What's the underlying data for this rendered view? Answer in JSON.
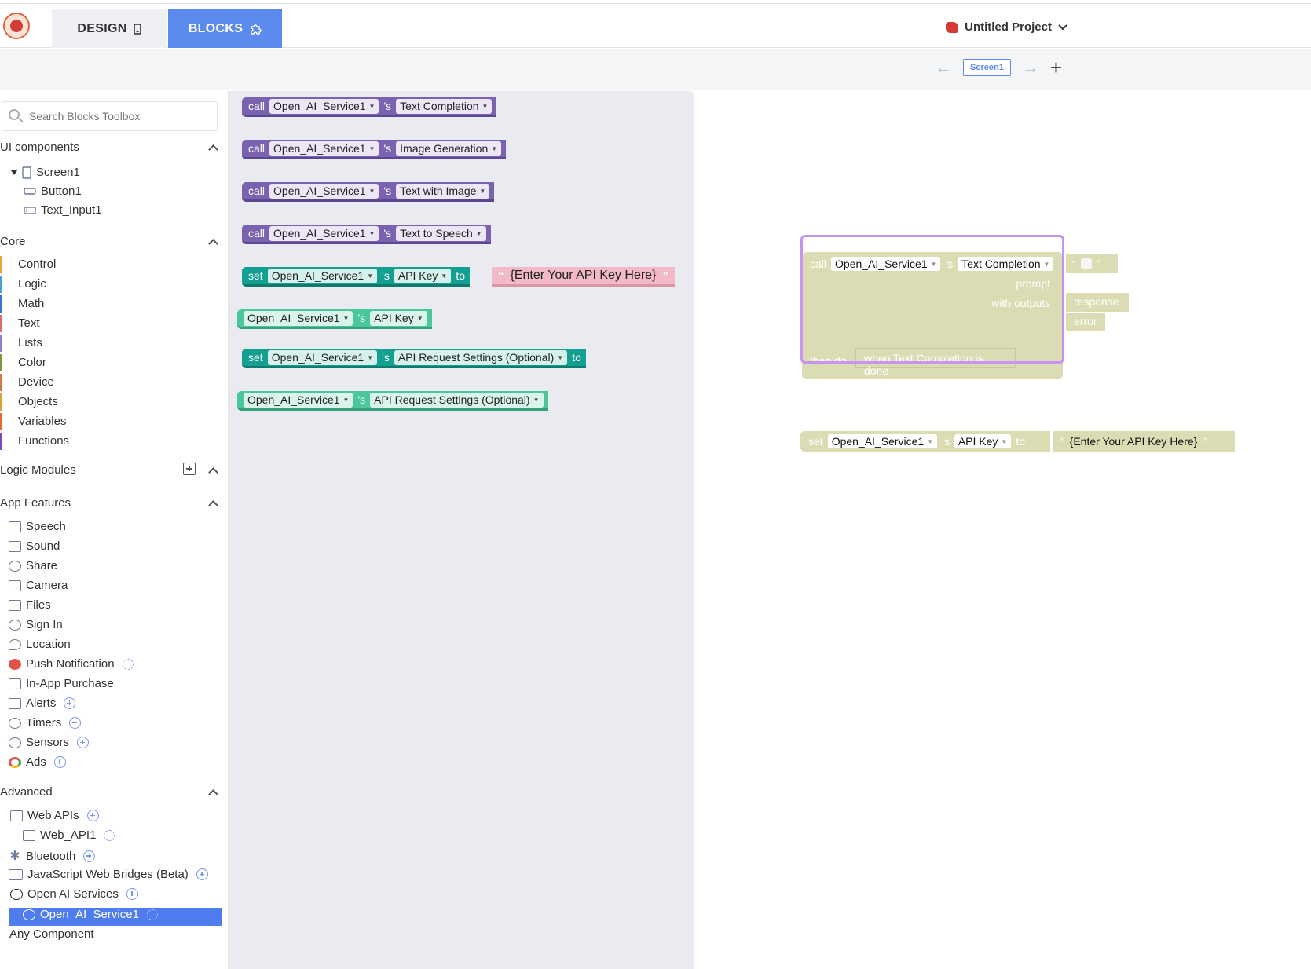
{
  "header": {
    "tabs": [
      {
        "label": "DESIGN",
        "icon": "phone-icon"
      },
      {
        "label": "BLOCKS",
        "icon": "puzzle-icon"
      }
    ],
    "project_name": "Untitled Project"
  },
  "screen_nav": {
    "screen_label": "Screen1"
  },
  "search": {
    "placeholder": "Search Blocks Toolbox"
  },
  "sidebar": {
    "ui_components": {
      "title": "UI components",
      "items": [
        "Screen1",
        "Button1",
        "Text_Input1"
      ]
    },
    "core": {
      "title": "Core",
      "items": [
        {
          "label": "Control",
          "color": "#e8a33d"
        },
        {
          "label": "Logic",
          "color": "#4a9fd8"
        },
        {
          "label": "Math",
          "color": "#3b6fd4"
        },
        {
          "label": "Text",
          "color": "#e06b6b"
        },
        {
          "label": "Lists",
          "color": "#8b7fd0"
        },
        {
          "label": "Color",
          "color": "#7a9a3a"
        },
        {
          "label": "Device",
          "color": "#d77a3f"
        },
        {
          "label": "Objects",
          "color": "#d9a03b"
        },
        {
          "label": "Variables",
          "color": "#e26a2f"
        },
        {
          "label": "Functions",
          "color": "#7a4bbf"
        }
      ]
    },
    "logic_modules": {
      "title": "Logic Modules"
    },
    "app_features": {
      "title": "App Features",
      "items": [
        {
          "label": "Speech",
          "icon": "speech-icon"
        },
        {
          "label": "Sound",
          "icon": "speaker-icon"
        },
        {
          "label": "Share",
          "icon": "share-icon"
        },
        {
          "label": "Camera",
          "icon": "camera-icon"
        },
        {
          "label": "Files",
          "icon": "folder-icon"
        },
        {
          "label": "Sign In",
          "icon": "user-icon"
        },
        {
          "label": "Location",
          "icon": "location-icon"
        },
        {
          "label": "Push Notification",
          "icon": "push-icon"
        },
        {
          "label": "In-App Purchase",
          "icon": "purchase-icon"
        },
        {
          "label": "Alerts",
          "icon": "alert-icon"
        },
        {
          "label": "Timers",
          "icon": "timer-icon"
        },
        {
          "label": "Sensors",
          "icon": "sensor-icon"
        },
        {
          "label": "Ads",
          "icon": "ads-icon"
        }
      ]
    },
    "advanced": {
      "title": "Advanced",
      "items": [
        {
          "label": "Web APIs",
          "icon": "api-icon"
        },
        {
          "label": "Web_API1",
          "icon": "api-icon"
        },
        {
          "label": "Bluetooth",
          "icon": "bluetooth-icon"
        },
        {
          "label": "JavaScript Web Bridges (Beta)",
          "icon": "window-icon"
        },
        {
          "label": "Open AI Services",
          "icon": "openai-icon"
        },
        {
          "label": "Open_AI_Service1",
          "icon": "openai-icon"
        }
      ],
      "any_component": "Any Component"
    }
  },
  "flyout": {
    "call": "call",
    "set": "set",
    "to": "to",
    "poss": "'s",
    "component": "Open_AI_Service1",
    "methods": [
      "Text Completion",
      "Image Generation",
      "Text with Image",
      "Text to Speech"
    ],
    "api_key": "API Key",
    "api_key_placeholder": "{Enter Your API Key Here}",
    "api_settings": "API Request Settings (Optional)"
  },
  "workspace": {
    "call_block": {
      "call": "call",
      "component": "Open_AI_Service1",
      "poss": "'s",
      "method": "Text Completion",
      "prompt": "prompt",
      "with_outputs": "with outputs",
      "response": "response",
      "error": "error",
      "then_do": "then do",
      "when_done": "when Text Completion is done"
    },
    "set_block": {
      "set": "set",
      "component": "Open_AI_Service1",
      "poss": "'s",
      "prop": "API Key",
      "to": "to",
      "value": "{Enter Your API Key Here}"
    }
  }
}
